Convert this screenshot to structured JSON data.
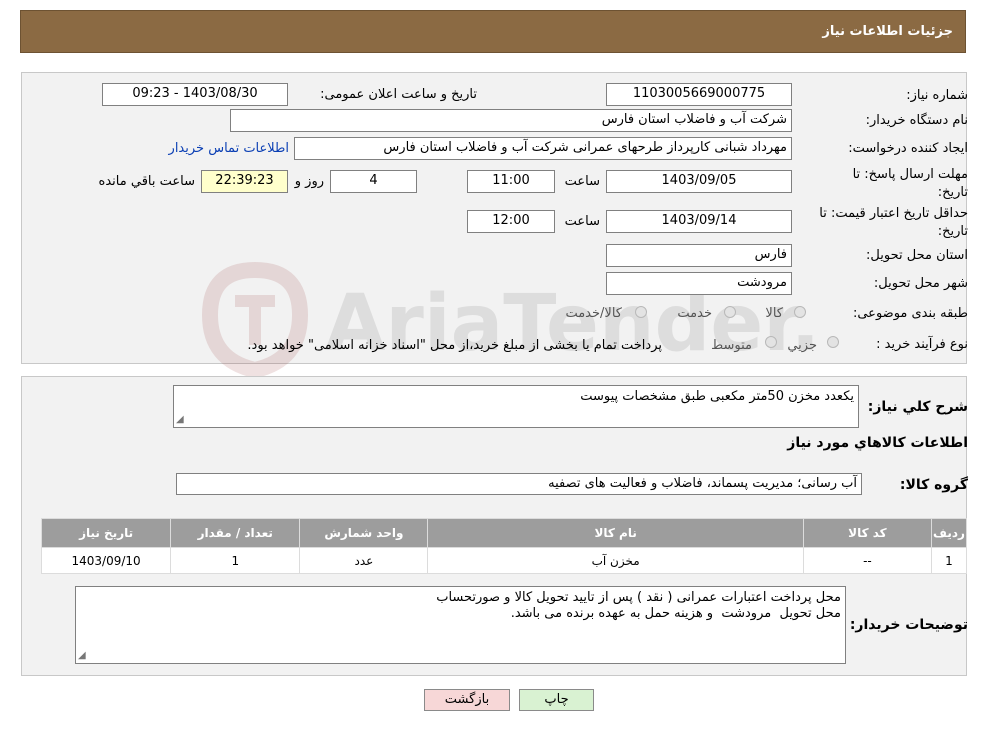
{
  "header": {
    "title": "جزئیات اطلاعات نیاز"
  },
  "details": {
    "need_number_label": "شماره نیاز:",
    "need_number": "1103005669000775",
    "announce_label": "تاریخ و ساعت اعلان عمومی:",
    "announce_value": "1403/08/30 - 09:23",
    "buyer_label": "نام دستگاه خریدار:",
    "buyer_value": "شرکت آب و فاضلاب استان فارس",
    "creator_label": "ایجاد کننده درخواست:",
    "creator_value": "مهرداد شبانی کارپرداز طرحهای عمرانی  شرکت آب و فاضلاب استان فارس",
    "contact_link": "اطلاعات تماس خریدار",
    "deadline_label_1": "مهلت ارسال پاسخ: تا",
    "deadline_label_2": "تاریخ:",
    "deadline_date": "1403/09/05",
    "time_label": "ساعت",
    "deadline_time": "11:00",
    "days_value": "4",
    "days_label": "روز و",
    "remaining_time": "22:39:23",
    "remaining_label": "ساعت باقي مانده",
    "validity_label_1": "حداقل تاریخ اعتبار قیمت: تا",
    "validity_label_2": "تاریخ:",
    "validity_date": "1403/09/14",
    "validity_time_label": "ساعت",
    "validity_time": "12:00",
    "province_label": "استان محل تحویل:",
    "province_value": "فارس",
    "city_label": "شهر محل تحویل:",
    "city_value": "مرودشت",
    "category_label": "طبقه بندی موضوعی:",
    "category_options": [
      "کالا",
      "خدمت",
      "کالا/خدمت"
    ],
    "process_label": "نوع فرآیند خرید :",
    "process_options": [
      "جزيي",
      "متوسط"
    ],
    "process_note": "پرداخت تمام یا بخشی از مبلغ خرید،از محل \"اسناد خزانه اسلامی\" خواهد بود."
  },
  "summary": {
    "description_label": "شرح کلي نياز:",
    "description_value": "یکعدد مخزن 50متر مکعبی طبق مشخصات پیوست",
    "goods_info_title": "اطلاعات کالاهاي مورد نياز",
    "goods_group_label": "گروه کالا:",
    "goods_group_value": "آب رسانی؛ مدیریت پسماند، فاضلاب و فعالیت های تصفیه",
    "table": {
      "headers": [
        "رديف",
        "کد کالا",
        "نام کالا",
        "واحد شمارش",
        "تعداد / مقدار",
        "تاريخ نياز"
      ],
      "rows": [
        [
          "1",
          "--",
          "مخزن آب",
          "عدد",
          "1",
          "1403/09/10"
        ]
      ]
    },
    "buyer_notes_label": "توضيحات خريدار:",
    "buyer_notes_value": "محل پرداخت اعتبارات عمرانی ( نقد ) پس از تایید تحویل کالا و صورتحساب\nمحل تحویل  مرودشت  و هزینه حمل به عهده برنده می باشد."
  },
  "buttons": {
    "print": "چاپ",
    "back": "بازگشت"
  },
  "watermark": "AriaTender.neT",
  "colors": {
    "header": "#8b6a43",
    "table_header": "#9d9d9d",
    "link": "#0b3fb4",
    "back_button": "#f7d7d7",
    "print_button": "#d9f2d2"
  }
}
